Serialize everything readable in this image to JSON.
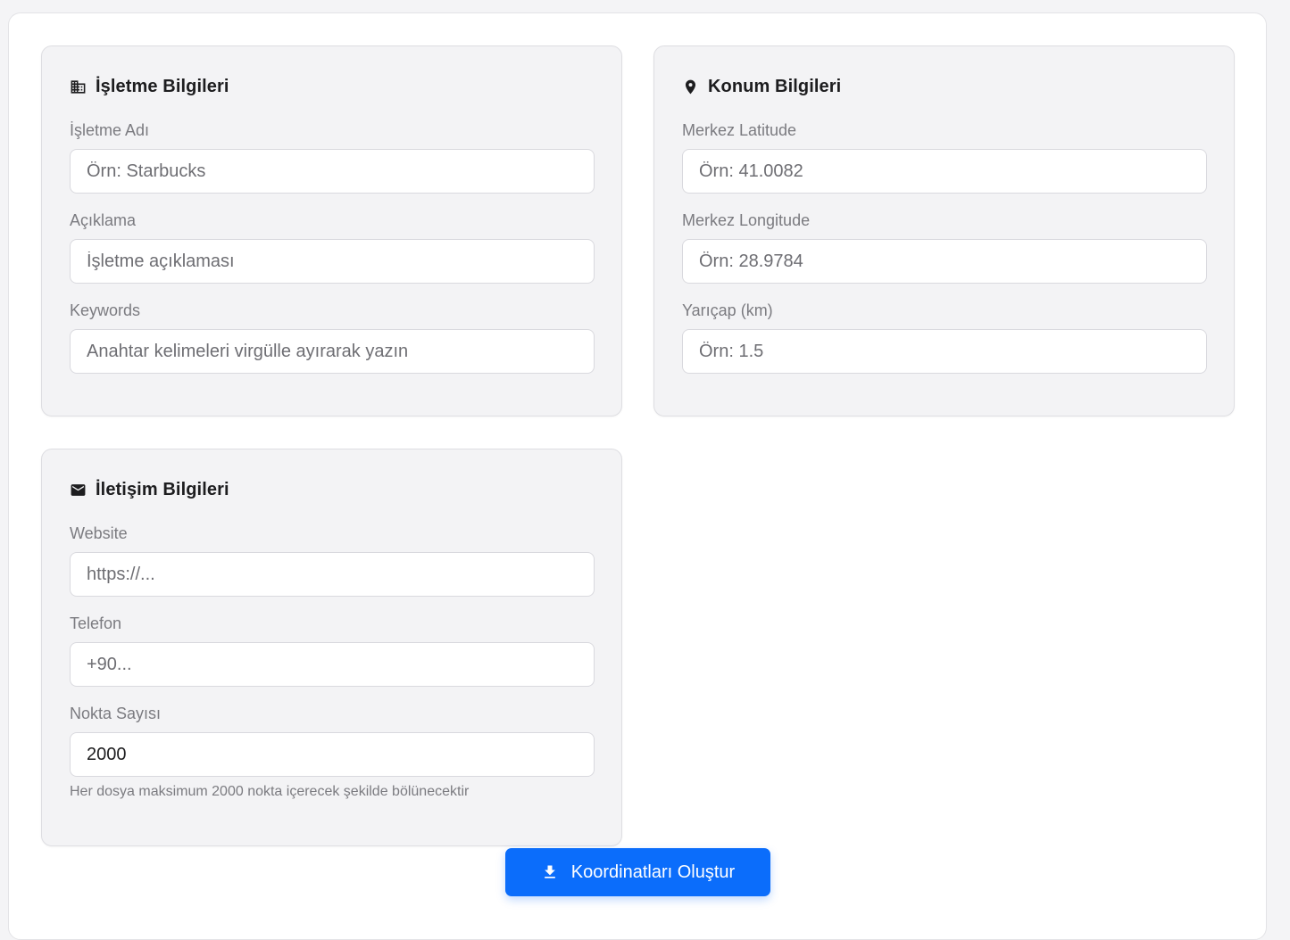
{
  "business": {
    "title": "İşletme Bilgileri",
    "icon": "building-icon",
    "name_label": "İşletme Adı",
    "name_placeholder": "Örn: Starbucks",
    "description_label": "Açıklama",
    "description_placeholder": "İşletme açıklaması",
    "keywords_label": "Keywords",
    "keywords_placeholder": "Anahtar kelimeleri virgülle ayırarak yazın"
  },
  "location": {
    "title": "Konum Bilgileri",
    "icon": "map-pin-icon",
    "lat_label": "Merkez Latitude",
    "lat_placeholder": "Örn: 41.0082",
    "lng_label": "Merkez Longitude",
    "lng_placeholder": "Örn: 28.9784",
    "radius_label": "Yarıçap (km)",
    "radius_placeholder": "Örn: 1.5"
  },
  "contact": {
    "title": "İletişim Bilgileri",
    "icon": "envelope-icon",
    "website_label": "Website",
    "website_placeholder": "https://...",
    "phone_label": "Telefon",
    "phone_placeholder": "+90...",
    "points_label": "Nokta Sayısı",
    "points_value": "2000",
    "points_hint": "Her dosya maksimum 2000 nokta içerecek şekilde bölünecektir"
  },
  "actions": {
    "submit_label": "Koordinatları Oluştur",
    "submit_icon": "download-icon",
    "accent_color": "#0b6dfb"
  }
}
